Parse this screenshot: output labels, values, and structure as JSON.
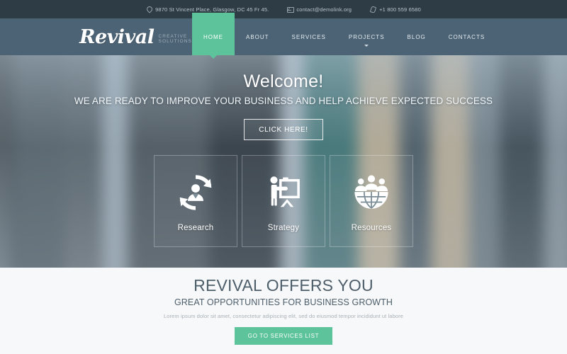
{
  "topbar": {
    "address": "9870 St Vincent Place, Glasgow, DC 45 Fr 45.",
    "email": "contact@demolink.org",
    "phone": "+1 800 559 6580"
  },
  "header": {
    "logo": "Revival",
    "logo_tagline": "CREATIVE SOLUTIONS",
    "nav": [
      {
        "label": "HOME",
        "active": true,
        "dropdown": false
      },
      {
        "label": "ABOUT",
        "active": false,
        "dropdown": false
      },
      {
        "label": "SERVICES",
        "active": false,
        "dropdown": false
      },
      {
        "label": "PROJECTS",
        "active": false,
        "dropdown": true
      },
      {
        "label": "BLOG",
        "active": false,
        "dropdown": false
      },
      {
        "label": "CONTACTS",
        "active": false,
        "dropdown": false
      }
    ]
  },
  "hero": {
    "title": "Welcome!",
    "subtitle": "WE ARE READY TO IMPROVE YOUR BUSINESS AND HELP ACHIEVE EXPECTED SUCCESS",
    "cta_label": "CLICK HERE!",
    "cards": [
      {
        "label": "Research",
        "icon": "person-refresh-cycle-icon"
      },
      {
        "label": "Strategy",
        "icon": "presenter-whiteboard-icon"
      },
      {
        "label": "Resources",
        "icon": "people-globe-icon"
      }
    ]
  },
  "offers": {
    "heading": "REVIVAL OFFERS YOU",
    "subheading": "GREAT OPPORTUNITIES FOR BUSINESS GROWTH",
    "description": "Lorem ipsum dolor sit amet, consectetur adipiscing elit, sed do eiusmod tempor incididunt ut labore",
    "button_label": "GO TO SERVICES LIST"
  },
  "colors": {
    "accent_green": "#5cc39a",
    "topbar_dark": "#2e3c45",
    "header_slate": "#4c6375",
    "heading_slate": "#4d5e6b",
    "section_bg": "#f7f8f9"
  }
}
